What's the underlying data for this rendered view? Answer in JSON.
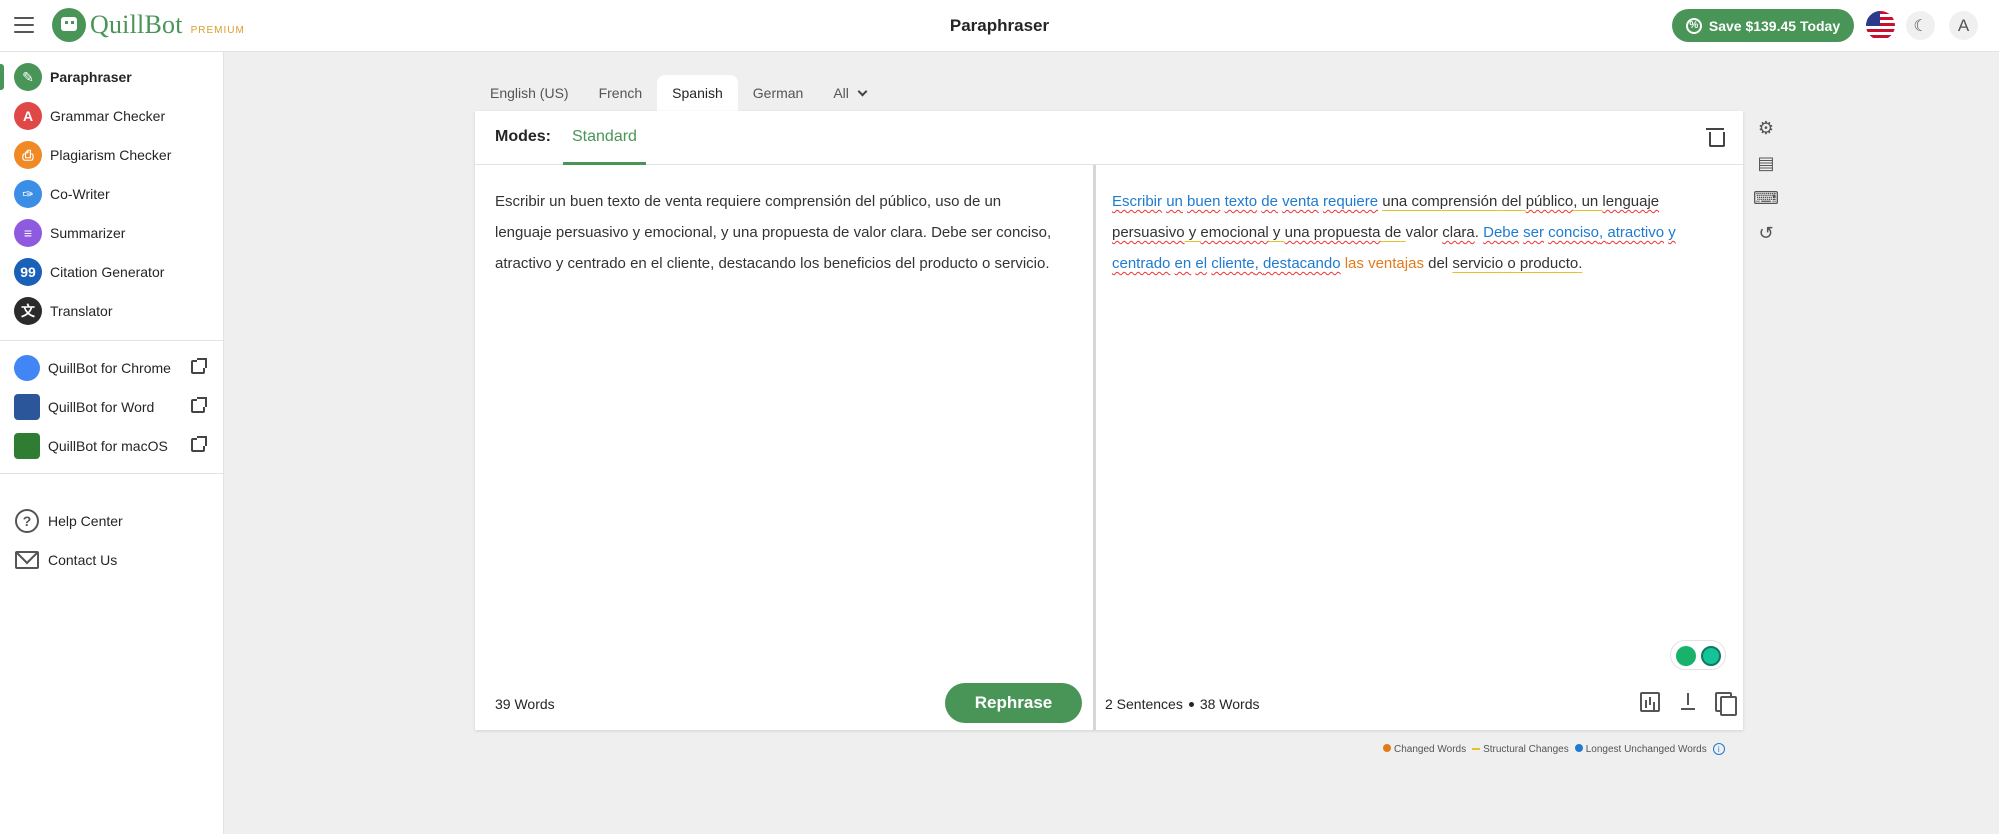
{
  "app": {
    "brand": "QuillBot",
    "brand_tier": "PREMIUM",
    "page_title": "Paraphraser",
    "save_offer": "Save $139.45 Today",
    "avatar_initial": "A"
  },
  "colors": {
    "brand_green": "#499557",
    "premium_gold": "#d9a02b",
    "changed_words": "#e27b1a",
    "structural_changes": "#e8c12a",
    "longest_unchanged": "#1e7bd0"
  },
  "sidebar": {
    "tools": [
      {
        "label": "Paraphraser",
        "icon": "paraphraser-icon",
        "color": "#499557",
        "glyph": "✎",
        "active": true
      },
      {
        "label": "Grammar Checker",
        "icon": "grammar-checker-icon",
        "color": "#e04848",
        "glyph": "A"
      },
      {
        "label": "Plagiarism Checker",
        "icon": "plagiarism-checker-icon",
        "color": "#f08a24",
        "glyph": "⎙"
      },
      {
        "label": "Co-Writer",
        "icon": "co-writer-icon",
        "color": "#3b8ee6",
        "glyph": "✑"
      },
      {
        "label": "Summarizer",
        "icon": "summarizer-icon",
        "color": "#8e5ae0",
        "glyph": "≡"
      },
      {
        "label": "Citation Generator",
        "icon": "citation-generator-icon",
        "color": "#1a5fb8",
        "glyph": "99"
      },
      {
        "label": "Translator",
        "icon": "translator-icon",
        "color": "#2b2b2b",
        "glyph": "文"
      }
    ],
    "extensions": [
      {
        "label": "QuillBot for Chrome",
        "icon": "chrome-icon"
      },
      {
        "label": "QuillBot for Word",
        "icon": "word-icon"
      },
      {
        "label": "QuillBot for macOS",
        "icon": "macos-icon"
      }
    ],
    "support": [
      {
        "label": "Help Center",
        "icon": "help-icon"
      },
      {
        "label": "Contact Us",
        "icon": "mail-icon"
      }
    ]
  },
  "languages": {
    "tabs": [
      "English (US)",
      "French",
      "Spanish",
      "German",
      "All"
    ],
    "active": "Spanish"
  },
  "editor": {
    "modes_label": "Modes:",
    "mode": "Standard",
    "input_text": "Escribir un buen texto de venta requiere comprensión del público, uso de un lenguaje persuasivo y emocional, y una propuesta de valor clara. Debe ser conciso, atractivo y centrado en el cliente, destacando los beneficios del producto o servicio.",
    "input_word_count": "39 Words",
    "rephrase_label": "Rephrase",
    "output_sentences": "2 Sentences",
    "output_words": "38 Words",
    "output_tokens": [
      {
        "t": "Escribir",
        "k": "syn"
      },
      {
        "t": " "
      },
      {
        "t": "un",
        "k": "syn"
      },
      {
        "t": " "
      },
      {
        "t": "buen",
        "k": "syn"
      },
      {
        "t": " "
      },
      {
        "t": "texto",
        "k": "syn"
      },
      {
        "t": " "
      },
      {
        "t": "de",
        "k": "syn"
      },
      {
        "t": " "
      },
      {
        "t": "venta",
        "k": "syn"
      },
      {
        "t": " "
      },
      {
        "t": "requiere",
        "k": "syn"
      },
      {
        "t": " "
      },
      {
        "t": "una comprensión",
        "k": "str"
      },
      {
        "t": " del ",
        "k": "str"
      },
      {
        "t": "público",
        "k": "err"
      },
      {
        "t": ", un ",
        "k": "str"
      },
      {
        "t": "lenguaje",
        "k": "err"
      },
      {
        "t": " "
      },
      {
        "t": "persuasivo",
        "k": "err"
      },
      {
        "t": " y ",
        "k": "str"
      },
      {
        "t": "emocional",
        "k": "err"
      },
      {
        "t": " y ",
        "k": "str"
      },
      {
        "t": "una propuesta",
        "k": "err"
      },
      {
        "t": " de ",
        "k": "str"
      },
      {
        "t": "valor"
      },
      {
        "t": " "
      },
      {
        "t": "clara",
        "k": "err"
      },
      {
        "t": ". "
      },
      {
        "t": "Debe",
        "k": "syn"
      },
      {
        "t": " "
      },
      {
        "t": "ser",
        "k": "syn"
      },
      {
        "t": " "
      },
      {
        "t": "conciso",
        "k": "syn"
      },
      {
        "t": ", ",
        "k": "syn"
      },
      {
        "t": "atractivo",
        "k": "syn"
      },
      {
        "t": " "
      },
      {
        "t": "y",
        "k": "syn"
      },
      {
        "t": " "
      },
      {
        "t": "centrado",
        "k": "syn"
      },
      {
        "t": " "
      },
      {
        "t": "en",
        "k": "syn"
      },
      {
        "t": " "
      },
      {
        "t": "el",
        "k": "syn"
      },
      {
        "t": " "
      },
      {
        "t": "cliente",
        "k": "syn"
      },
      {
        "t": ", ",
        "k": "syn"
      },
      {
        "t": "destacando",
        "k": "syn"
      },
      {
        "t": " "
      },
      {
        "t": "las",
        "k": "chg"
      },
      {
        "t": " "
      },
      {
        "t": "ventajas",
        "k": "chg"
      },
      {
        "t": " del "
      },
      {
        "t": "servicio",
        "k": "str"
      },
      {
        "t": " o ",
        "k": "str"
      },
      {
        "t": "producto",
        "k": "str"
      },
      {
        "t": ".",
        "k": "str"
      }
    ]
  },
  "legend": {
    "changed": "Changed Words",
    "structural": "Structural Changes",
    "unchanged": "Longest Unchanged Words"
  }
}
